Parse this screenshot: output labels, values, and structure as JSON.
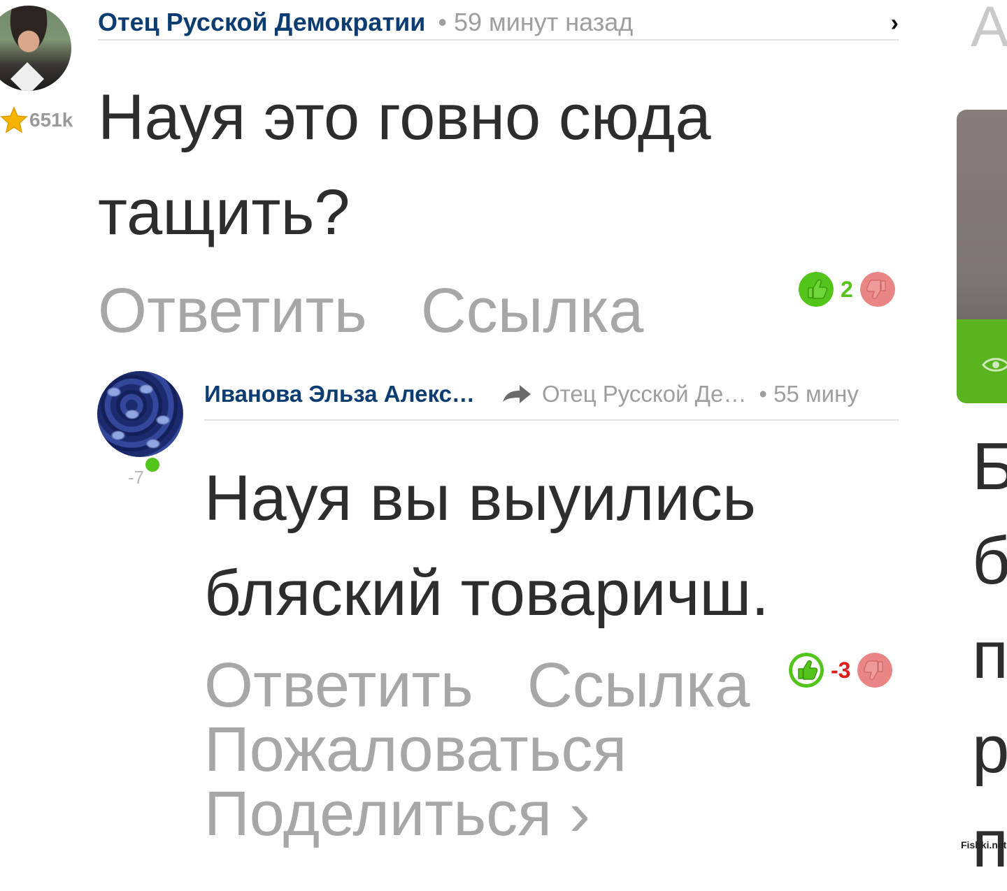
{
  "comment1": {
    "author": "Отец Русской Демократии",
    "time": "• 59 минут назад",
    "rating": "651k",
    "text_line1": "Науя это говно сюда",
    "text_line2": "тащить?",
    "actions": {
      "reply": "Ответить",
      "link": "Ссылка"
    },
    "votes": {
      "count": "2",
      "count_color": "#52c41a"
    },
    "close_icon": "chevron-right-icon"
  },
  "comment2": {
    "author": "Иванова Эльза Алекс…",
    "reply_to": "Отец Русской Де…",
    "time": "• 55 мину",
    "rating": "-7",
    "online": true,
    "text_line1": "Науя вы выуились",
    "text_line2": "бляский товаричш.",
    "actions": {
      "reply": "Ответить",
      "link": "Ссылка",
      "report": "Пожаловаться",
      "share": "Поделиться ›"
    },
    "votes": {
      "count": "-3",
      "count_color": "#e01b1b"
    }
  },
  "sidebar": {
    "cut_letter": "А",
    "cut_text": [
      "Б",
      "б",
      "п",
      "р",
      "п"
    ]
  },
  "watermark": "Fishki.net",
  "colors": {
    "author": "#0b3d72",
    "muted": "#9e9e9e",
    "like": "#52c41a",
    "dislike": "#e98585",
    "accent_green": "#5ab420"
  }
}
